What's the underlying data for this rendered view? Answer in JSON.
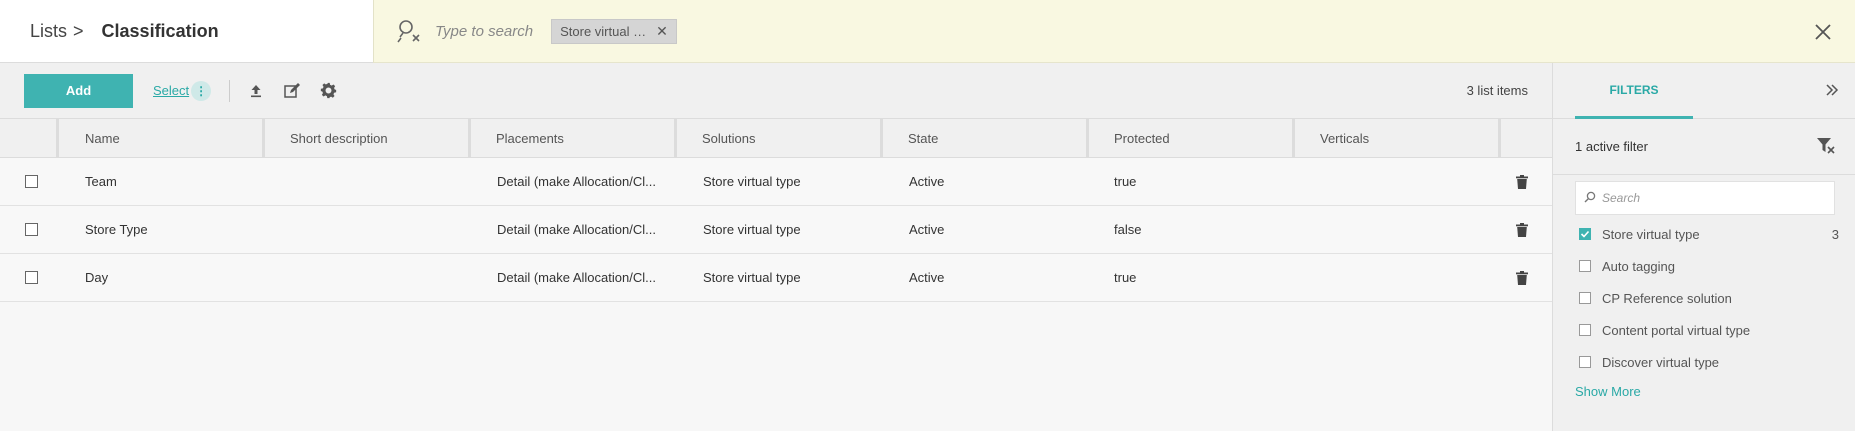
{
  "breadcrumb": {
    "parent": "Lists",
    "separator": ">",
    "current": "Classification"
  },
  "search": {
    "placeholder": "Type to search",
    "chip_label": "Store virtual t..."
  },
  "toolbar": {
    "add_label": "Add",
    "select_label": "Select",
    "count_text": "3 list items"
  },
  "table": {
    "columns": [
      "Name",
      "Short description",
      "Placements",
      "Solutions",
      "State",
      "Protected",
      "Verticals"
    ],
    "rows": [
      {
        "name": "Team",
        "short_description": "",
        "placements": "Detail (make Allocation/Cl...",
        "solutions": "Store virtual type",
        "state": "Active",
        "protected": "true",
        "verticals": ""
      },
      {
        "name": "Store Type",
        "short_description": "",
        "placements": "Detail (make Allocation/Cl...",
        "solutions": "Store virtual type",
        "state": "Active",
        "protected": "false",
        "verticals": ""
      },
      {
        "name": "Day",
        "short_description": "",
        "placements": "Detail (make Allocation/Cl...",
        "solutions": "Store virtual type",
        "state": "Active",
        "protected": "true",
        "verticals": ""
      }
    ]
  },
  "panel": {
    "tab_label": "FILTERS",
    "active_filter_text": "1 active filter",
    "search_placeholder": "Search",
    "filters": [
      {
        "label": "Store virtual type",
        "checked": true,
        "count": "3"
      },
      {
        "label": "Auto tagging",
        "checked": false,
        "count": ""
      },
      {
        "label": "CP Reference solution",
        "checked": false,
        "count": ""
      },
      {
        "label": "Content portal virtual type",
        "checked": false,
        "count": ""
      },
      {
        "label": "Discover virtual type",
        "checked": false,
        "count": ""
      }
    ],
    "show_more_label": "Show More"
  },
  "colors": {
    "accent": "#3fb3b1",
    "search_bar_bg": "#f9f8e1",
    "link": "#2aa9a6"
  },
  "icons": {
    "search": "search-person-clear-icon",
    "close": "close-icon",
    "upload": "upload-icon",
    "edit": "edit-icon",
    "settings": "gear-icon",
    "delete": "trash-icon",
    "collapse": "double-chevron-right-icon",
    "clear_filter": "filter-clear-icon"
  }
}
